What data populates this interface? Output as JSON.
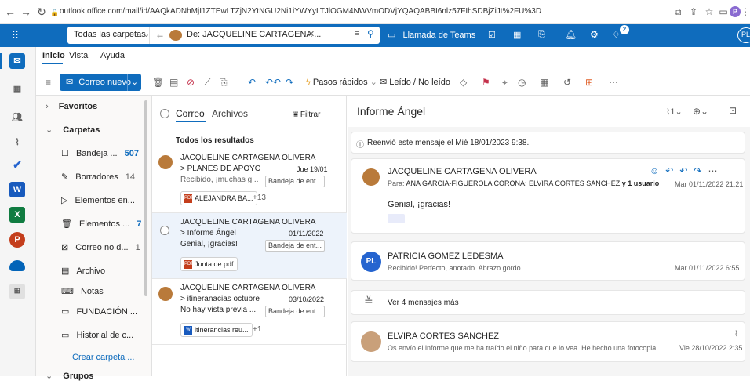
{
  "browser": {
    "url": "outlook.office.com/mail/id/AAQkADNhMjI1ZTEwLTZjN2YtNGU2Ni1iYWYyLTJlOGM4NWVmODVjYQAQABBI6nlz57FIhSDBjZiJt%2FU%3D"
  },
  "appbar": {
    "folder_selector": "Todas las carpetas",
    "search_query": "De: JACQUELINE CARTAGENA ...",
    "teams_label": "Llamada de Teams",
    "profile_initials": "PL",
    "notification_count": "2"
  },
  "ribbon": {
    "tabs": [
      "Inicio",
      "Vista",
      "Ayuda"
    ],
    "new_mail_label": "Correo nuevo",
    "quick_steps_label": "Pasos rápidos",
    "read_unread_label": "Leído / No leído"
  },
  "folders": {
    "favorites": "Favoritos",
    "folders_header": "Carpetas",
    "items": [
      {
        "label": "Bandeja ...",
        "count": "507"
      },
      {
        "label": "Borradores",
        "count": "14"
      },
      {
        "label": "Elementos en...",
        "count": ""
      },
      {
        "label": "Elementos ...",
        "count": "7"
      },
      {
        "label": "Correo no d...",
        "count": "1"
      },
      {
        "label": "Archivo",
        "count": ""
      },
      {
        "label": "Notas",
        "count": ""
      },
      {
        "label": "FUNDACIÓN ...",
        "count": ""
      },
      {
        "label": "Historial de c...",
        "count": ""
      }
    ],
    "create_folder": "Crear carpeta ...",
    "groups_header": "Grupos"
  },
  "list": {
    "tab_mail": "Correo",
    "tab_files": "Archivos",
    "filter_label": "Filtrar",
    "section_header": "Todos los resultados",
    "messages": [
      {
        "sender": "JACQUELINE CARTAGENA OLIVERA",
        "subject": "> PLANES DE APOYO",
        "date": "Jue 19/01",
        "preview": "Recibido, ¡muchas g...",
        "folder": "Bandeja de ent...",
        "attachment": "ALEJANDRA BA...",
        "extra": "+13"
      },
      {
        "sender": "JACQUELINE CARTAGENA OLIVERA",
        "subject": "> Informe Ángel",
        "date": "01/11/2022",
        "preview": "Genial, ¡gracias!",
        "folder": "Bandeja de ent...",
        "attachment": "Junta de.pdf",
        "extra": ""
      },
      {
        "sender": "JACQUELINE CARTAGENA OLIVERA",
        "subject": "> itineranacias octubre",
        "date": "03/10/2022",
        "preview": "No hay vista previa ...",
        "folder": "Bandeja de ent...",
        "attachment": "itinerancias reu...",
        "extra": "+1"
      }
    ]
  },
  "reading": {
    "subject": "Informe Ángel",
    "attachment_count": "1",
    "forwarded_notice": "Reenvió este mensaje el Mié 18/01/2023 9:38.",
    "msg1": {
      "sender": "JACQUELINE CARTAGENA OLIVERA",
      "to_label": "Para:",
      "recipients": "ANA GARCIA-FIGUEROLA CORONA;  ELVIRA CORTES SANCHEZ",
      "more_users": "y 1 usuario",
      "date": "Mar 01/11/2022 21:21",
      "body": "Genial, ¡gracias!",
      "ellipsis": "..."
    },
    "msg2": {
      "initials": "PL",
      "sender": "PATRICIA GOMEZ LEDESMA",
      "preview": "Recibido! Perfecto, anotado. Abrazo gordo.",
      "date": "Mar 01/11/2022 6:55"
    },
    "more_messages": "Ver 4 mensajes más",
    "msg3": {
      "sender": "ELVIRA CORTES SANCHEZ",
      "preview": "Os envío el informe que me ha traído el niño para que lo vea. He hecho una fotocopia ...",
      "date": "Vie 28/10/2022 2:35"
    }
  },
  "colors": {
    "brand": "#0f6cbd",
    "selected": "#edf3fb"
  }
}
